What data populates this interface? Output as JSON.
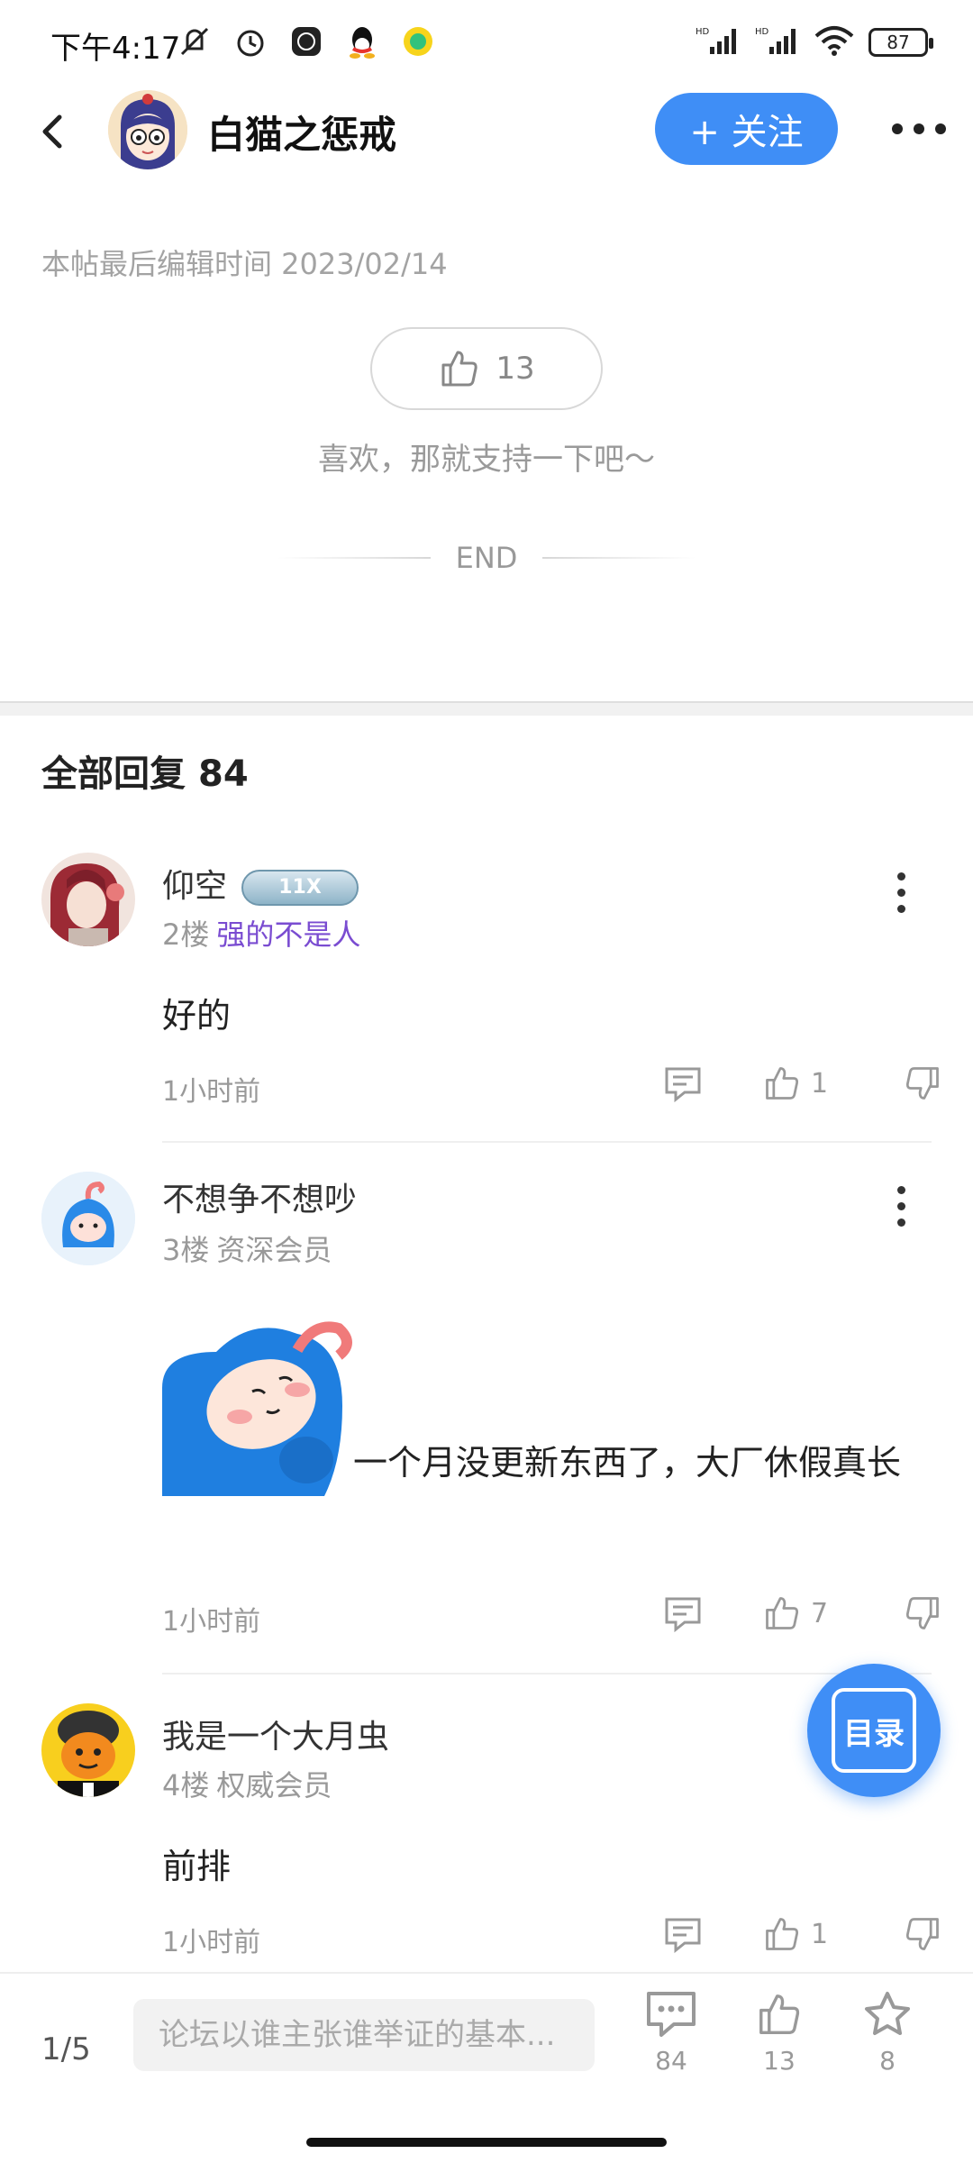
{
  "status_bar": {
    "time": "下午4:17",
    "battery": "87"
  },
  "header": {
    "author_name": "白猫之惩戒",
    "follow_label": "+ 关注"
  },
  "post": {
    "edit_time": "本帖最后编辑时间 2023/02/14",
    "like_count": "13",
    "support_text": "喜欢，那就支持一下吧～",
    "end_text": "END"
  },
  "replies": {
    "title": "全部回复",
    "count": "84",
    "items": [
      {
        "name": "仰空",
        "badge": "11X",
        "floor": "2楼",
        "tag": "强的不是人",
        "body": "好的",
        "time": "1小时前",
        "likes": "1"
      },
      {
        "name": "不想争不想吵",
        "floor": "3楼",
        "tag": "资深会员",
        "body": "一个月没更新东西了，大厂休假真长",
        "time": "1小时前",
        "likes": "7"
      },
      {
        "name": "我是一个大月虫",
        "floor": "4楼",
        "tag": "权威会员",
        "body": "前排",
        "time": "1小时前",
        "likes": "1"
      }
    ]
  },
  "toc_button": "目录",
  "bottom_bar": {
    "page_indicator": "1/5",
    "input_placeholder": "论坛以谁主张谁举证的基本...",
    "comments": "84",
    "likes": "13",
    "favorites": "8"
  },
  "colors": {
    "accent": "#3f8ef6",
    "tag_purple": "#7a4cd1",
    "muted_text": "#999999"
  }
}
